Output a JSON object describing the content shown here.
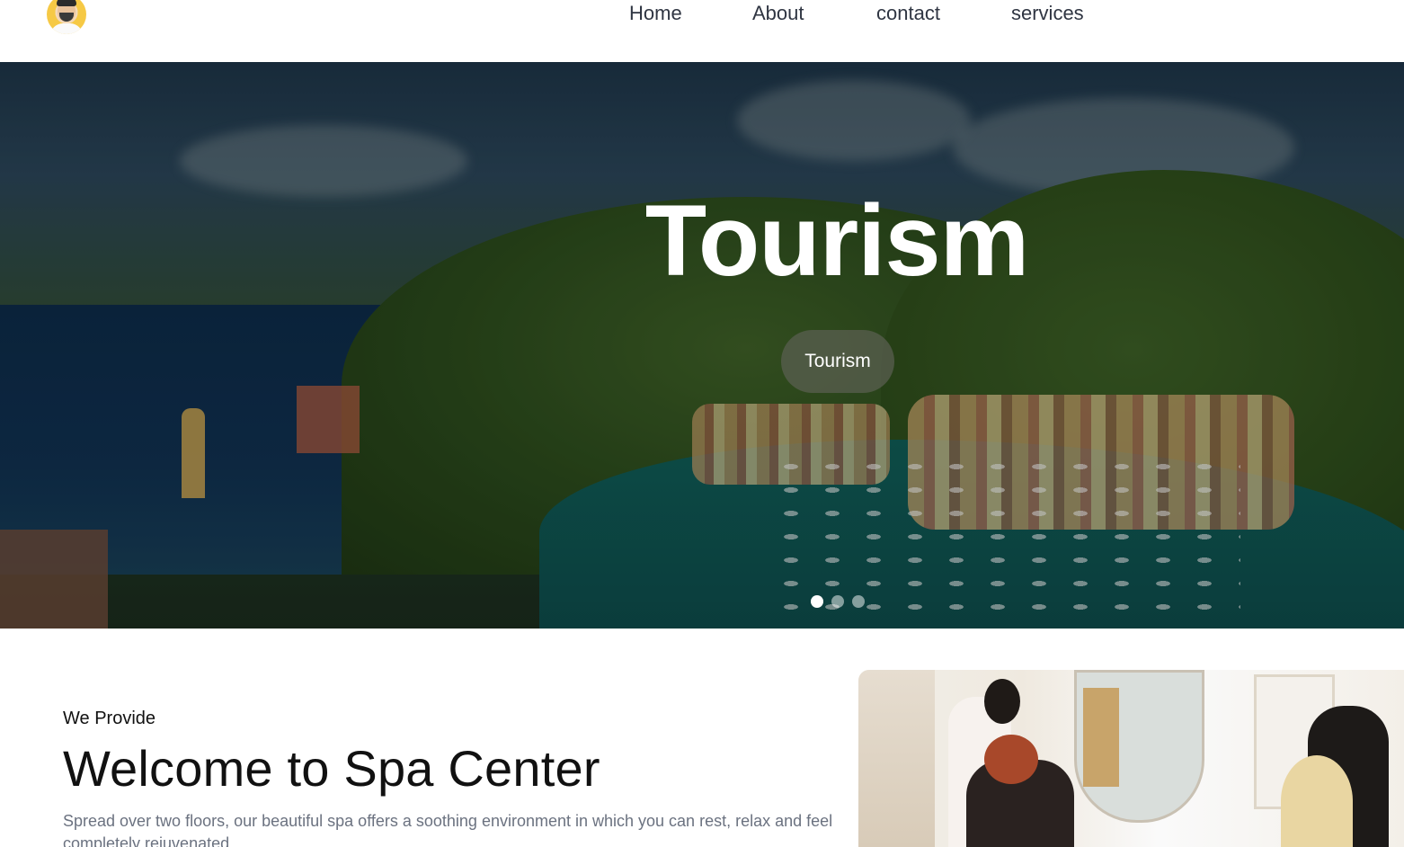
{
  "header": {
    "logo_alt": "avatar",
    "nav": [
      {
        "label": "Home"
      },
      {
        "label": "About"
      },
      {
        "label": "contact"
      },
      {
        "label": "services"
      }
    ]
  },
  "hero": {
    "title": "Tourism",
    "button_label": "Tourism",
    "slides_count": 3,
    "active_slide": 1
  },
  "welcome": {
    "eyebrow": "We Provide",
    "title": "Welcome to Spa Center",
    "text": "Spread over two floors, our beautiful spa offers a soothing environment in which you can rest, relax and feel completely rejuvenated."
  },
  "colors": {
    "nav_text": "#2f3542",
    "body_text": "#111111",
    "muted_text": "#6b7280",
    "hero_button_bg": "#5a5f50"
  }
}
